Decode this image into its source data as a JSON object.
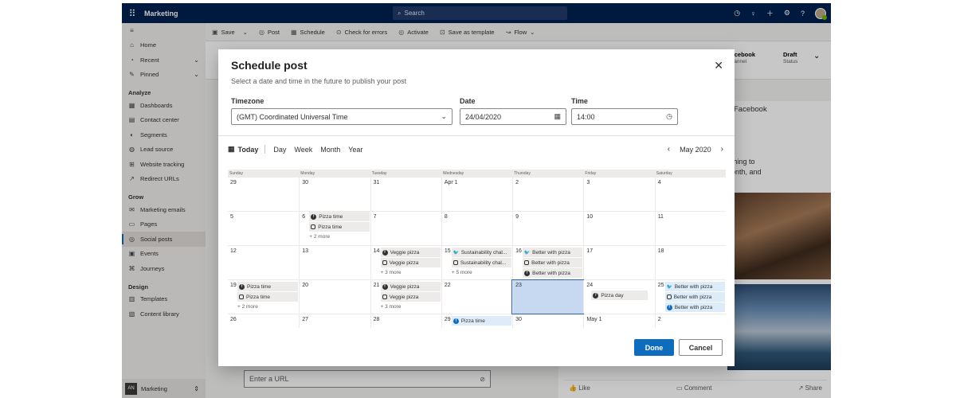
{
  "app": {
    "name": "Marketing",
    "search_placeholder": "Search"
  },
  "sidebar": {
    "items": [
      {
        "label": "Home",
        "icon": "home-icon"
      },
      {
        "label": "Recent",
        "icon": "clock-icon"
      },
      {
        "label": "Pinned",
        "icon": "pin-icon"
      }
    ],
    "sections": [
      {
        "title": "Analyze",
        "items": [
          "Dashboards",
          "Contact center",
          "Segments",
          "Lead source",
          "Website tracking",
          "Redirect URLs"
        ]
      },
      {
        "title": "Grow",
        "items": [
          "Marketing emails",
          "Pages",
          "Social posts",
          "Events",
          "Journeys"
        ]
      },
      {
        "title": "Design",
        "items": [
          "Templates",
          "Content library"
        ]
      }
    ],
    "active": "Social posts",
    "area": {
      "badge": "AN",
      "label": "Marketing"
    }
  },
  "toolbar": {
    "save": "Save",
    "post": "Post",
    "schedule": "Schedule",
    "check_errors": "Check for errors",
    "activate": "Activate",
    "save_template": "Save as template",
    "flow": "Flow"
  },
  "record_header": {
    "channel_value": "Facebook",
    "channel_label": "Channel",
    "status_value": "Draft",
    "status_label": "Status"
  },
  "preview": {
    "channel": "Facebook",
    "text_line1": "thing to",
    "text_line2": "onth, and",
    "like": "Like",
    "comment": "Comment",
    "share": "Share"
  },
  "url_field": {
    "placeholder": "Enter a URL"
  },
  "modal": {
    "title": "Schedule post",
    "subtitle": "Select a date and time in the future to publish your post",
    "timezone_label": "Timezone",
    "timezone_value": "(GMT) Coordinated Universal Time",
    "date_label": "Date",
    "date_value": "24/04/2020",
    "time_label": "Time",
    "time_value": "14:00",
    "nav": {
      "today": "Today",
      "views": [
        "Day",
        "Week",
        "Month",
        "Year"
      ]
    },
    "month_label": "May 2020",
    "day_headers": [
      "Sunday",
      "Monday",
      "Tuesday",
      "Wednesday",
      "Thursday",
      "Friday",
      "Saturday"
    ],
    "weeks": [
      [
        "29",
        "30",
        "31",
        "Apr 1",
        "2",
        "3",
        "4"
      ],
      [
        "5",
        "6",
        "7",
        "8",
        "9",
        "10",
        "11"
      ],
      [
        "12",
        "13",
        "14",
        "15",
        "16",
        "17",
        "18"
      ],
      [
        "19",
        "20",
        "21",
        "22",
        "23",
        "24",
        "25"
      ],
      [
        "26",
        "27",
        "28",
        "29",
        "30",
        "May 1",
        "2"
      ]
    ],
    "events": {
      "w1_mon": [
        "Pizza time",
        "Pizza time"
      ],
      "w1_mon_more": "+ 2 more",
      "w2_tue": [
        "Veggie pizza",
        "Veggie pizza"
      ],
      "w2_tue_more": "+ 3 more",
      "w2_wed": [
        "Sustainability chal...",
        "Sustainability chal..."
      ],
      "w2_wed_more": "+ 5 more",
      "w2_thu": [
        "Better with pizza",
        "Better with pizza",
        "Better with pizza"
      ],
      "w3_sun": [
        "Pizza time",
        "Pizza time"
      ],
      "w3_sun_more": "+ 2 more",
      "w3_tue": [
        "Veggie pizza",
        "Veggie pizza"
      ],
      "w3_tue_more": "+ 3 more",
      "w3_fri": [
        "Pizza day"
      ],
      "w3_sat": [
        "Better with pizza",
        "Better with pizza",
        "Better with pizza"
      ],
      "w4_wed": [
        "Pizza time"
      ]
    },
    "done": "Done",
    "cancel": "Cancel"
  }
}
